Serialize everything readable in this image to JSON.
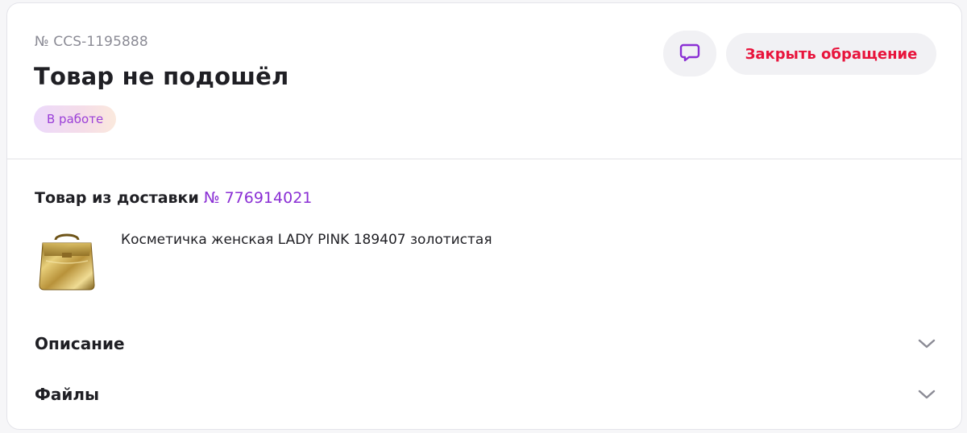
{
  "ticket": {
    "number": "№ CCS-1195888",
    "title": "Товар не подошёл",
    "status": "В работе"
  },
  "actions": {
    "chat_icon": "chat-bubble-icon",
    "close_label": "Закрыть обращение"
  },
  "delivery": {
    "label": "Товар из доставки",
    "number": "№ 776914021"
  },
  "product": {
    "name": "Косметичка женская LADY PINK 189407 золотистая",
    "image_icon": "golden-cosmetic-bag-image"
  },
  "sections": [
    {
      "label": "Описание",
      "icon": "chevron-down-icon"
    },
    {
      "label": "Файлы",
      "icon": "chevron-down-icon"
    }
  ],
  "colors": {
    "accent_purple": "#8a2fd4",
    "close_red": "#e8143c",
    "button_bg": "#f1f1f4",
    "status_text": "#9b3fd8"
  }
}
